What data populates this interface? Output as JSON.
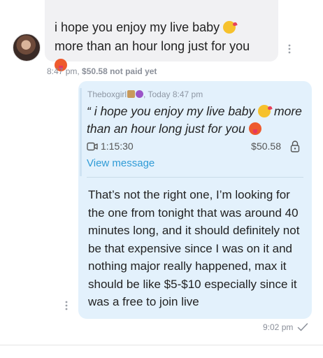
{
  "incoming": {
    "text_part1": "i hope you enjoy my live baby",
    "emoji1": "kissing-face-emoji",
    "text_part2": "more than an hour long just for you",
    "emoji2": "hot-face-emoji",
    "time": "8:47 pm,",
    "price_status": "$50.58 not paid yet"
  },
  "outgoing": {
    "quote": {
      "sender": "Theboxgirl",
      "sender_emojis": [
        "package-emoji",
        "smiling-devil-emoji"
      ],
      "date": ", Today 8:47 pm",
      "text_part1": "“ i hope you enjoy my live baby",
      "text_part2": "more than an hour long just for you",
      "duration": "1:15:30",
      "price": "$50.58",
      "view_message": "View message"
    },
    "text": "That’s not the right one, I’m looking for the one from tonight that was around 40 minutes long, and it should definitely not be that expensive since I was on it and nothing major really happened, max it should be like $5-$10 especially since it was a free to join live",
    "time": "9:02 pm"
  },
  "colors": {
    "incoming_bubble": "#f1f1f3",
    "outgoing_bubble": "#e3f1fc",
    "link": "#2f9bd6",
    "meta_text": "#8a8f99"
  }
}
